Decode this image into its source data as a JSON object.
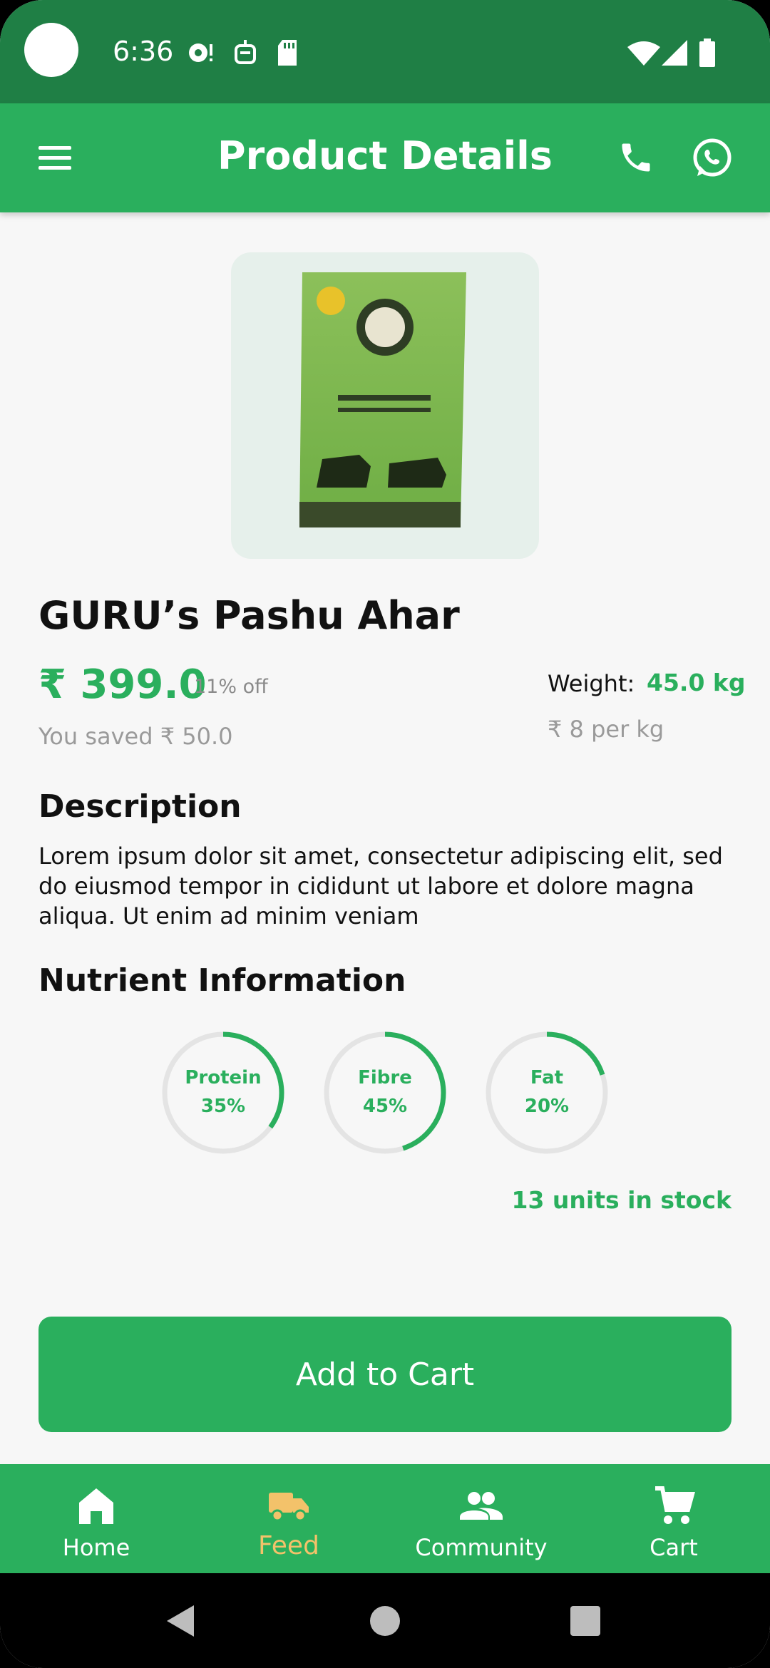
{
  "status_bar": {
    "time": "6:36"
  },
  "app_bar": {
    "title": "Product Details"
  },
  "product": {
    "name": "GURU’s Pashu Ahar",
    "price": "₹ 399.0",
    "discount": "11% off",
    "saved": "You saved ₹ 50.0",
    "weight_label": "Weight:",
    "weight_value": "45.0 kg",
    "per_kg": "₹ 8 per kg",
    "stock": "13 units in stock"
  },
  "description": {
    "title": "Description",
    "body": "Lorem ipsum dolor sit amet, consectetur adipiscing elit, sed do eiusmod tempor in cididunt ut labore et dolore magna aliqua. Ut enim ad minim veniam"
  },
  "nutrients": {
    "title": "Nutrient Information",
    "items": [
      {
        "name": "Protein",
        "value": "35%",
        "fraction": 0.35
      },
      {
        "name": "Fibre",
        "value": "45%",
        "fraction": 0.45
      },
      {
        "name": "Fat",
        "value": "20%",
        "fraction": 0.2
      }
    ]
  },
  "actions": {
    "add_to_cart": "Add to Cart"
  },
  "bottom_nav": {
    "items": [
      {
        "label": "Home",
        "icon": "home-icon",
        "active": false
      },
      {
        "label": "Feed",
        "icon": "truck-icon",
        "active": true
      },
      {
        "label": "Community",
        "icon": "people-icon",
        "active": false
      },
      {
        "label": "Cart",
        "icon": "cart-icon",
        "active": false
      }
    ]
  },
  "colors": {
    "primary": "#2aaf5d",
    "status_bar": "#1f7f45",
    "active_nav": "#f3c26a",
    "ring_track": "#e4e4e4"
  }
}
